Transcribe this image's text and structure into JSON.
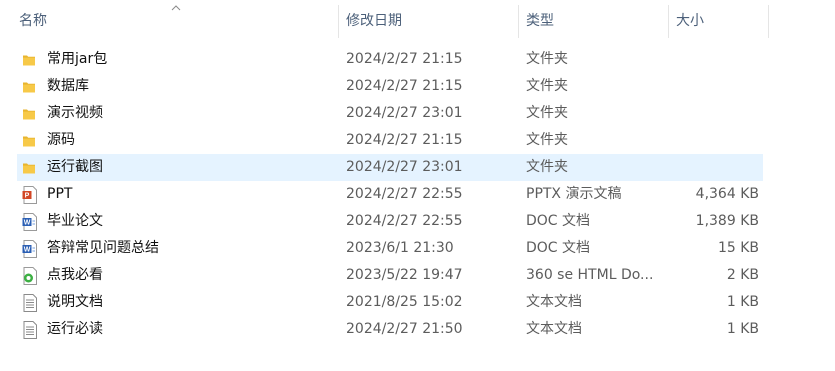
{
  "columns": {
    "name": "名称",
    "date": "修改日期",
    "type": "类型",
    "size": "大小"
  },
  "files": [
    {
      "name": "常用jar包",
      "date": "2024/2/27 21:15",
      "type": "文件夹",
      "size": "",
      "icon": "folder-icon"
    },
    {
      "name": "数据库",
      "date": "2024/2/27 21:15",
      "type": "文件夹",
      "size": "",
      "icon": "folder-icon"
    },
    {
      "name": "演示视频",
      "date": "2024/2/27 23:01",
      "type": "文件夹",
      "size": "",
      "icon": "folder-icon"
    },
    {
      "name": "源码",
      "date": "2024/2/27 21:15",
      "type": "文件夹",
      "size": "",
      "icon": "folder-icon"
    },
    {
      "name": "运行截图",
      "date": "2024/2/27 23:01",
      "type": "文件夹",
      "size": "",
      "icon": "folder-icon"
    },
    {
      "name": "PPT",
      "date": "2024/2/27 22:55",
      "type": "PPTX 演示文稿",
      "size": "4,364 KB",
      "icon": "pptx-file-icon"
    },
    {
      "name": "毕业论文",
      "date": "2024/2/27 22:55",
      "type": "DOC 文档",
      "size": "1,389 KB",
      "icon": "doc-file-icon"
    },
    {
      "name": "答辩常见问题总结",
      "date": "2023/6/1 21:30",
      "type": "DOC 文档",
      "size": "15 KB",
      "icon": "doc-file-icon"
    },
    {
      "name": "点我必看",
      "date": "2023/5/22 19:47",
      "type": "360 se HTML Do...",
      "size": "2 KB",
      "icon": "html-file-icon"
    },
    {
      "name": "说明文档",
      "date": "2021/8/25 15:02",
      "type": "文本文档",
      "size": "1 KB",
      "icon": "text-file-icon"
    },
    {
      "name": "运行必读",
      "date": "2024/2/27 21:50",
      "type": "文本文档",
      "size": "1 KB",
      "icon": "text-file-icon"
    }
  ],
  "state": {
    "sort_column": "name",
    "highlighted_row_index": 4
  },
  "colors": {
    "folder": "#f7c948",
    "selection": "#cce8ff",
    "header_text": "#4c607a"
  }
}
